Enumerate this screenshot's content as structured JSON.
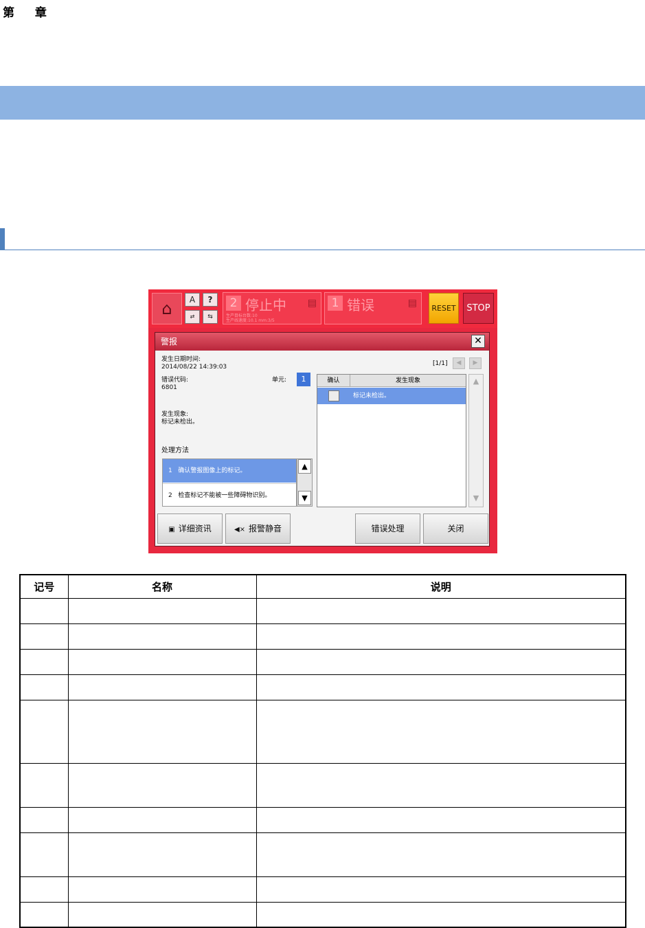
{
  "chapter": {
    "heading": "第 章"
  },
  "ui": {
    "status1": {
      "num": "2",
      "label": "停止中",
      "sub1": "生产目标台数:10",
      "sub2": "生产线速度:10.1 mm:3/5"
    },
    "status2": {
      "num": "1",
      "label": "错误",
      "sub1": "",
      "sub2": ""
    },
    "reset_label": "RESET",
    "stop_label": "STOP",
    "dialog": {
      "title": "警报",
      "close_glyph": "✕",
      "datetime_label": "发生日期时间:",
      "datetime_value": "2014/08/22 14:39:03",
      "page_indicator": "[1/1]",
      "error_code_label": "错误代码:",
      "error_code_value": "6801",
      "unit_label": "单元:",
      "unit_value": "1",
      "phenomenon_label": "发生现象:",
      "phenomenon_value": "标记未检出。",
      "method_label": "处理方法",
      "methods": [
        {
          "no": "1",
          "text": "确认警报图像上的标记。"
        },
        {
          "no": "2",
          "text": "检查标记不能被一些障碍物识别。"
        }
      ],
      "event_table": {
        "col_confirm": "确认",
        "col_phenomenon": "发生现象",
        "row_text": "标记未检出。"
      },
      "buttons": {
        "detail": "详细资讯",
        "mute": "报警静音",
        "handle": "错误处理",
        "close": "关闭"
      }
    }
  },
  "table": {
    "headers": [
      "记号",
      "名称",
      "说明"
    ],
    "rows": [
      [
        "",
        "",
        ""
      ],
      [
        "",
        "",
        ""
      ],
      [
        "",
        "",
        ""
      ],
      [
        "",
        "",
        ""
      ],
      [
        "",
        "",
        ""
      ],
      [
        "",
        "",
        ""
      ],
      [
        "",
        "",
        ""
      ],
      [
        "",
        "",
        ""
      ],
      [
        "",
        "",
        ""
      ],
      [
        "",
        "",
        ""
      ]
    ]
  }
}
